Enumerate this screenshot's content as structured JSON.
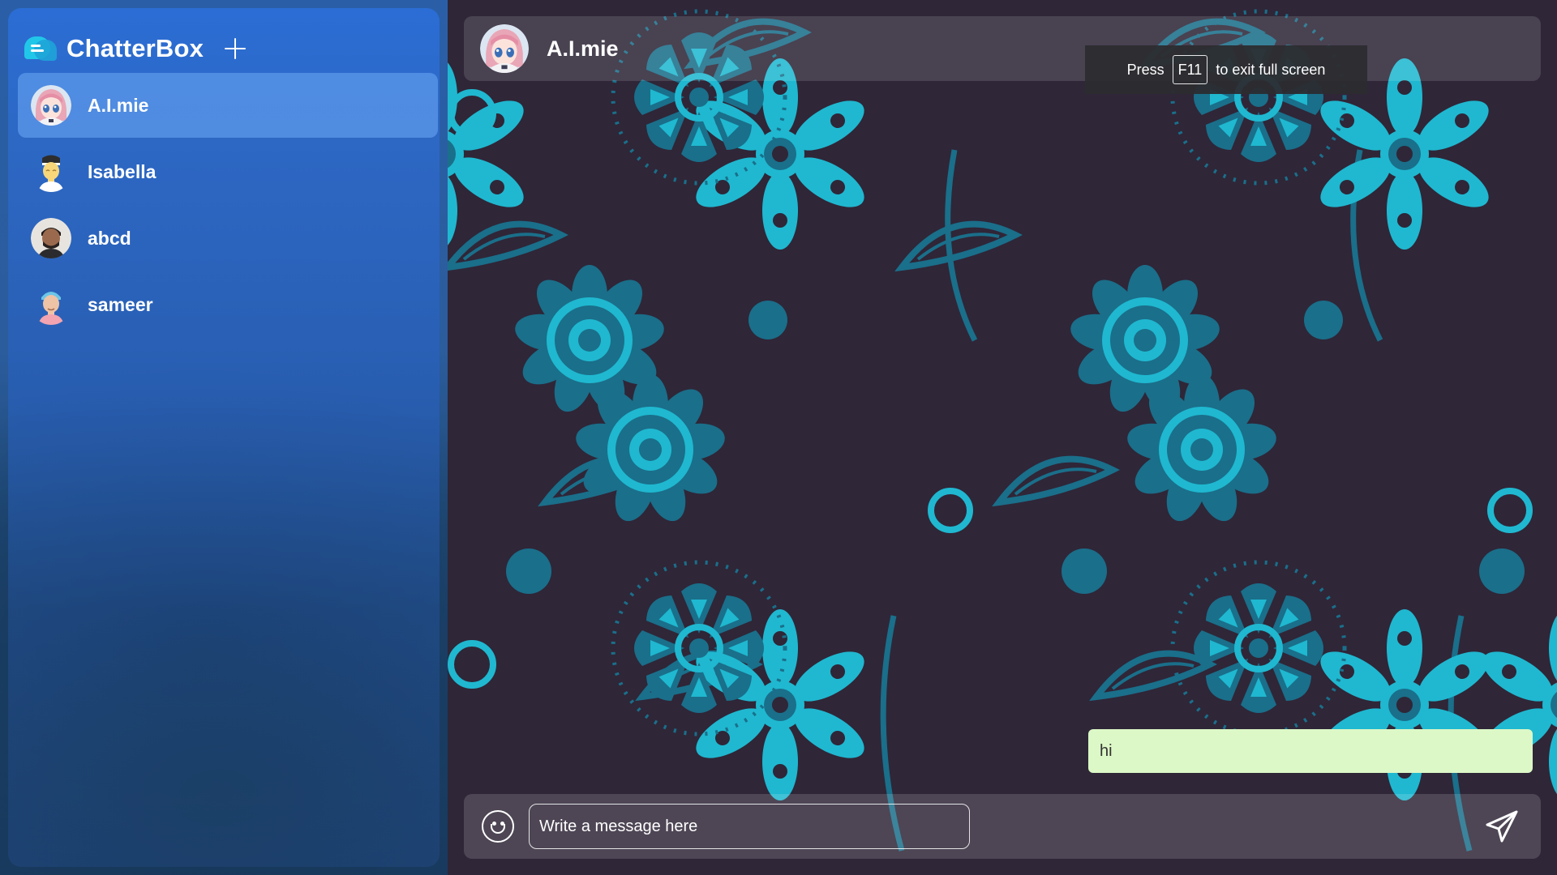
{
  "app": {
    "name": "ChatterBox",
    "add_icon": "plus-icon",
    "logo_icon": "chat-bubbles-logo"
  },
  "sidebar": {
    "contacts": [
      {
        "name": "A.I.mie",
        "active": true,
        "avatar": "anime-girl-avatar"
      },
      {
        "name": "Isabella",
        "active": false,
        "avatar": "person-avatar"
      },
      {
        "name": "abcd",
        "active": false,
        "avatar": "photo-avatar"
      },
      {
        "name": "sameer",
        "active": false,
        "avatar": "person-avatar"
      }
    ]
  },
  "chat": {
    "header": {
      "name": "A.I.mie",
      "avatar": "anime-girl-avatar"
    },
    "messages": [
      {
        "text": "hi",
        "direction": "outgoing"
      }
    ],
    "composer": {
      "placeholder": "Write a message here",
      "value": "",
      "emoji_icon": "smiley-icon",
      "send_icon": "send-icon"
    }
  },
  "fullscreen_toast": {
    "before": "Press",
    "key": "F11",
    "after": "to exit full screen"
  },
  "colors": {
    "sidebar_blue": "#2b6ed7",
    "chat_bg": "#2f2638",
    "pattern_cyan": "#1fb8d0",
    "pattern_dark": "#1a6f8a",
    "bubble": "#dcf8c6"
  }
}
